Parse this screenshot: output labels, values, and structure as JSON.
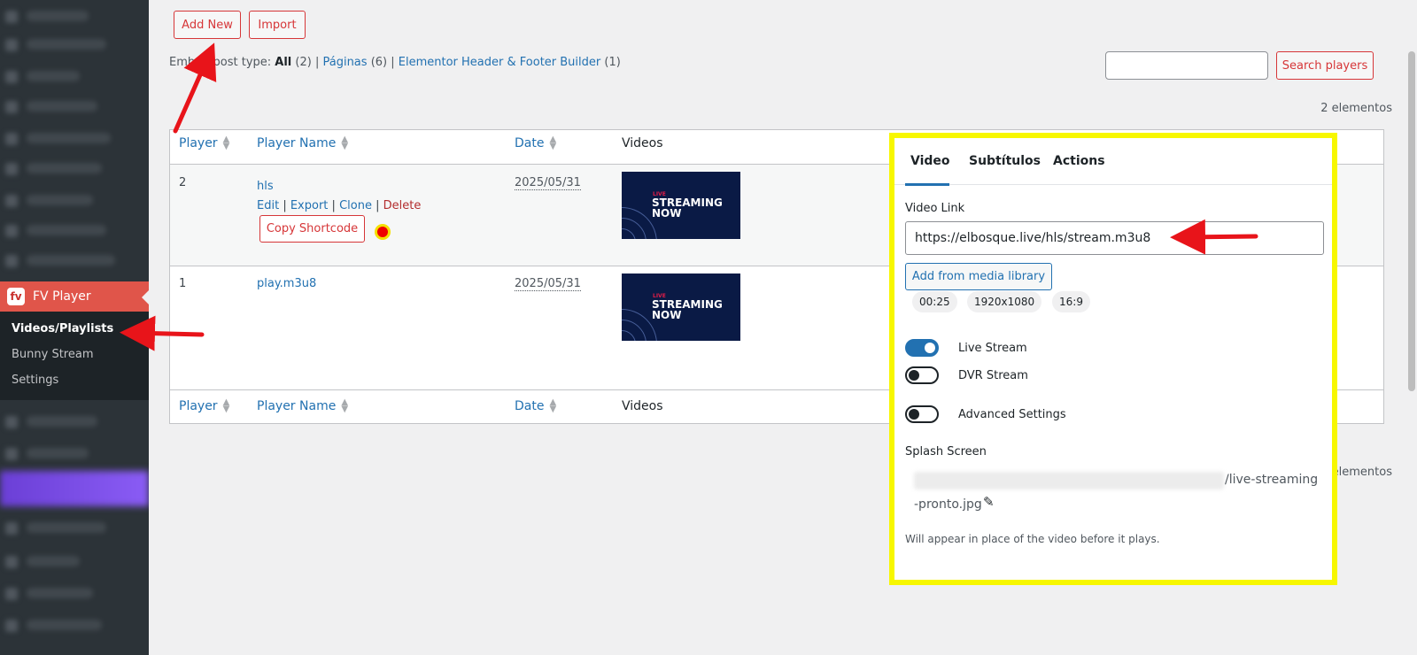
{
  "sidebar": {
    "menu_logo": "fv",
    "menu_label": "FV Player",
    "submenu": [
      "Videos/Playlists",
      "Bunny Stream",
      "Settings"
    ]
  },
  "toolbar": {
    "add_new": "Add New",
    "import": "Import"
  },
  "filters": {
    "prefix": "Embed post type:",
    "all_label": "All",
    "all_count": "(2)",
    "paginas_label": "Páginas",
    "paginas_count": "(6)",
    "elementor_label": "Elementor Header & Footer Builder",
    "elementor_count": "(1)"
  },
  "search": {
    "button": "Search players",
    "value": ""
  },
  "item_count": "2 elementos",
  "item_count_bottom": "elementos",
  "table": {
    "columns": [
      "Player",
      "Player Name",
      "Date",
      "Videos"
    ],
    "rows": [
      {
        "id": "2",
        "name": "hls",
        "actions": [
          "Edit",
          "Export",
          "Clone",
          "Delete"
        ],
        "copy_shortcode": "Copy Shortcode",
        "date": "2025/05/31",
        "thumb_live": "LIVE",
        "thumb_text": "STREAMING NOW"
      },
      {
        "id": "1",
        "name": "play.m3u8",
        "date": "2025/05/31",
        "thumb_live": "LIVE",
        "thumb_text": "STREAMING NOW"
      }
    ]
  },
  "panel": {
    "tabs": [
      "Video",
      "Subtítulos",
      "Actions"
    ],
    "video_link_label": "Video Link",
    "video_link_value": "https://elbosque.live/hls/stream.m3u8",
    "add_media": "Add from media library",
    "chips": [
      "00:25",
      "1920x1080",
      "16:9"
    ],
    "toggles": [
      {
        "label": "Live Stream",
        "on": true
      },
      {
        "label": "DVR Stream",
        "on": false
      },
      {
        "label": "Advanced Settings",
        "on": false
      }
    ],
    "splash_label": "Splash Screen",
    "splash_url_end": "/live-streaming",
    "splash_url_tail": "-pronto.jpg",
    "splash_help": "Will appear in place of the video before it plays."
  },
  "colors": {
    "accent": "#2271b1",
    "danger": "#d63638",
    "highlight": "#f7f700",
    "sidebar": "#2c3338",
    "fv_menu": "#e0554a"
  }
}
